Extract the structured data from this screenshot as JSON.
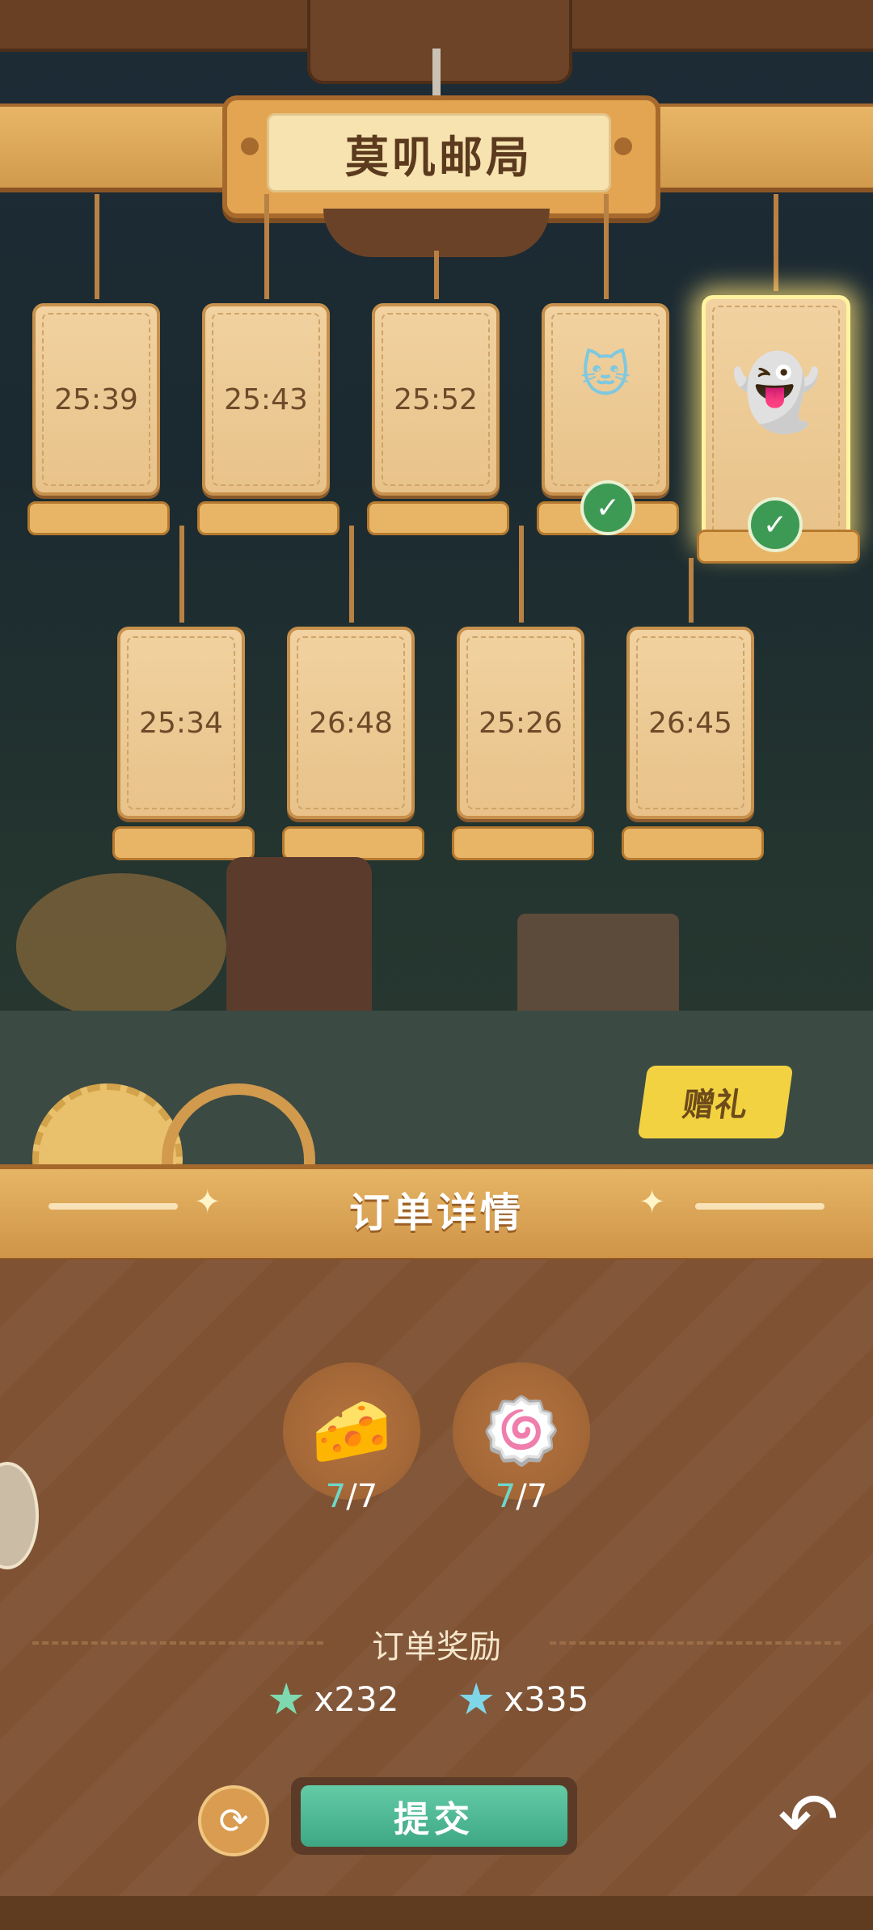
{
  "header": {
    "title": "莫叽邮局"
  },
  "orders": [
    {
      "label": "25:39",
      "state": "timer"
    },
    {
      "label": "25:43",
      "state": "timer"
    },
    {
      "label": "25:52",
      "state": "timer"
    },
    {
      "label": "",
      "state": "ready",
      "icon": "blue-cat-icon"
    },
    {
      "label": "",
      "state": "selected-ready",
      "icon": "white-ghost-icon"
    },
    {
      "label": "25:34",
      "state": "timer"
    },
    {
      "label": "26:48",
      "state": "timer"
    },
    {
      "label": "25:26",
      "state": "timer"
    },
    {
      "label": "26:45",
      "state": "timer"
    }
  ],
  "gift_button": {
    "label": "赠礼"
  },
  "detail": {
    "title": "订单详情"
  },
  "items": [
    {
      "icon": "cheese-icon",
      "have": "7",
      "sep": "/",
      "need": "7"
    },
    {
      "icon": "swirl-roll-icon",
      "have": "7",
      "sep": "/",
      "need": "7"
    }
  ],
  "rewards": {
    "title": "订单奖励",
    "list": [
      {
        "icon": "green-star-icon",
        "amount": "x232",
        "color": "#7fd9b0"
      },
      {
        "icon": "blue-star-icon",
        "amount": "x335",
        "color": "#7fd6e8"
      }
    ]
  },
  "buttons": {
    "submit": "提交"
  }
}
